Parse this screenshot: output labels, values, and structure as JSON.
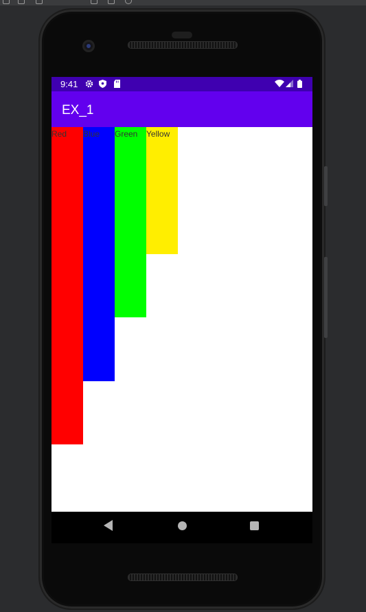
{
  "status_bar": {
    "time": "9:41"
  },
  "app_bar": {
    "title": "EX_1"
  },
  "columns": [
    {
      "label": "Red",
      "color": "#ff0000",
      "level": 1.0
    },
    {
      "label": "Blue",
      "color": "#0000ff",
      "level": 0.8
    },
    {
      "label": "Green",
      "color": "#00ff00",
      "level": 0.6
    },
    {
      "label": "Yellow",
      "color": "#ffee00",
      "level": 0.4
    }
  ],
  "colors": {
    "status_bar": "#3f00b0",
    "app_bar": "#6200ee"
  }
}
